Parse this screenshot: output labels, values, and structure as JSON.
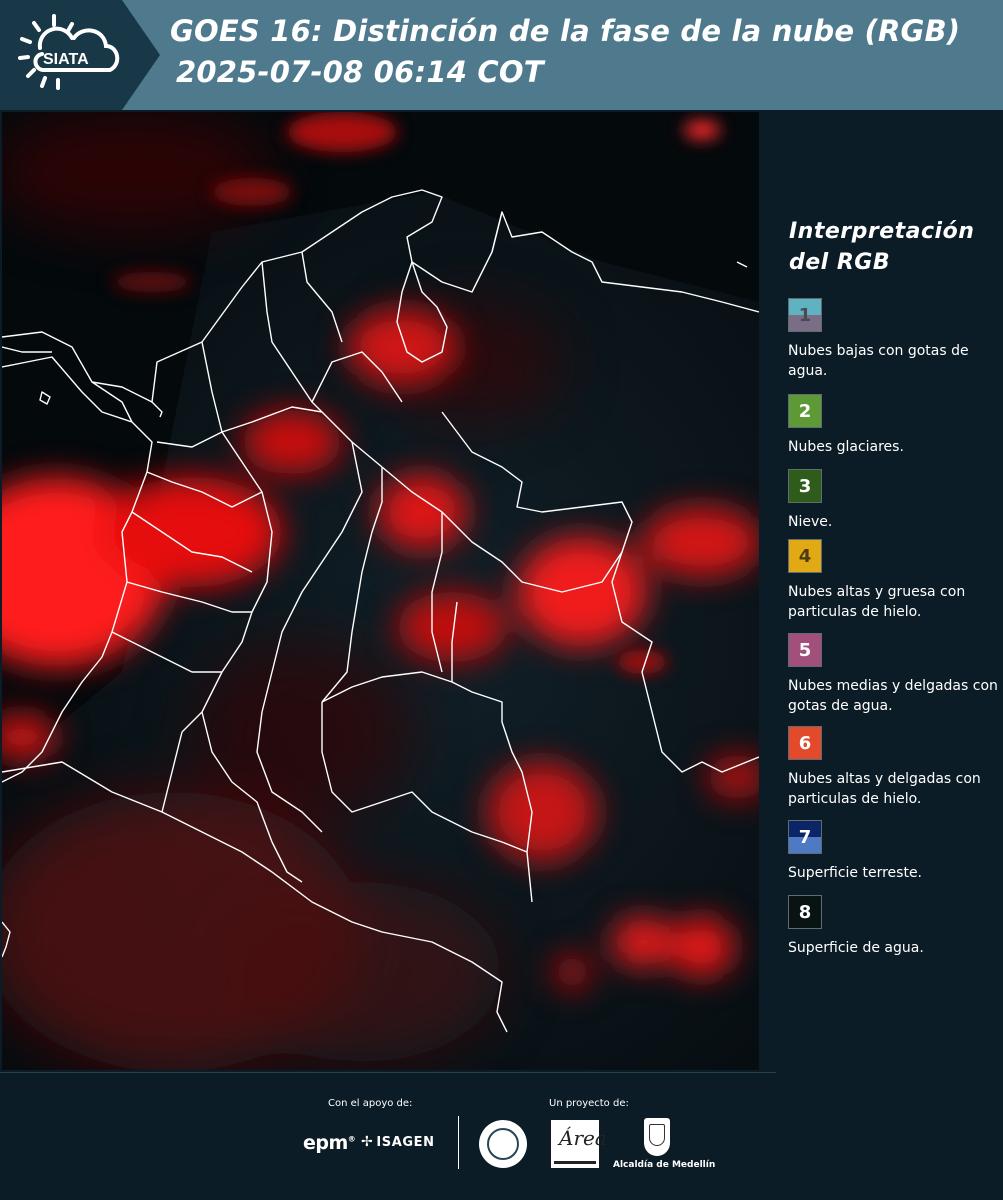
{
  "header": {
    "logo_text": "SIATA",
    "title_line1": "GOES 16: Distinción de la fase de la nube (RGB)",
    "title_line2": "2025-07-08 06:14 COT"
  },
  "legend": {
    "title": "Interpretación del RGB",
    "items": [
      {
        "num": "1",
        "label": "Nubes bajas con gotas de agua.",
        "color_top": "#5fb3c1",
        "color_bottom": "#7a6e86",
        "num_color": "#4a4a55"
      },
      {
        "num": "2",
        "label": "Nubes glaciares.",
        "color_top": "#5d9a36",
        "color_bottom": "#5d9a36",
        "num_color": "#ffffff"
      },
      {
        "num": "3",
        "label": "Nieve.",
        "color_top": "#2f5c1a",
        "color_bottom": "#2f5c1a",
        "num_color": "#ffffff"
      },
      {
        "num": "4",
        "label": "Nubes altas y gruesa con particulas de hielo.",
        "color_top": "#e1a914",
        "color_bottom": "#e1a914",
        "num_color": "#4a3c10"
      },
      {
        "num": "5",
        "label": "Nubes medias y delgadas con gotas de agua.",
        "color_top": "#a34f7c",
        "color_bottom": "#a34f7c",
        "num_color": "#ffffff"
      },
      {
        "num": "6",
        "label": "Nubes altas y delgadas con particulas de hielo.",
        "color_top": "#e24a2b",
        "color_bottom": "#e24a2b",
        "num_color": "#ffffff"
      },
      {
        "num": "7",
        "label": "Superficie terreste.",
        "color_top": "#0c2566",
        "color_bottom": "#4d7ac3",
        "num_color": "#ffffff"
      },
      {
        "num": "8",
        "label": "Superficie de agua.",
        "color_top": "#0a1313",
        "color_bottom": "#0a1313",
        "num_color": "#ffffff"
      }
    ]
  },
  "footer": {
    "support_label": "Con el apoyo de:",
    "project_label": "Un proyecto de:",
    "logos": {
      "epm": "epm",
      "isagen": "ISAGEN",
      "area_mark": "Área",
      "alcaldia": "Alcaldía de Medellín"
    }
  }
}
